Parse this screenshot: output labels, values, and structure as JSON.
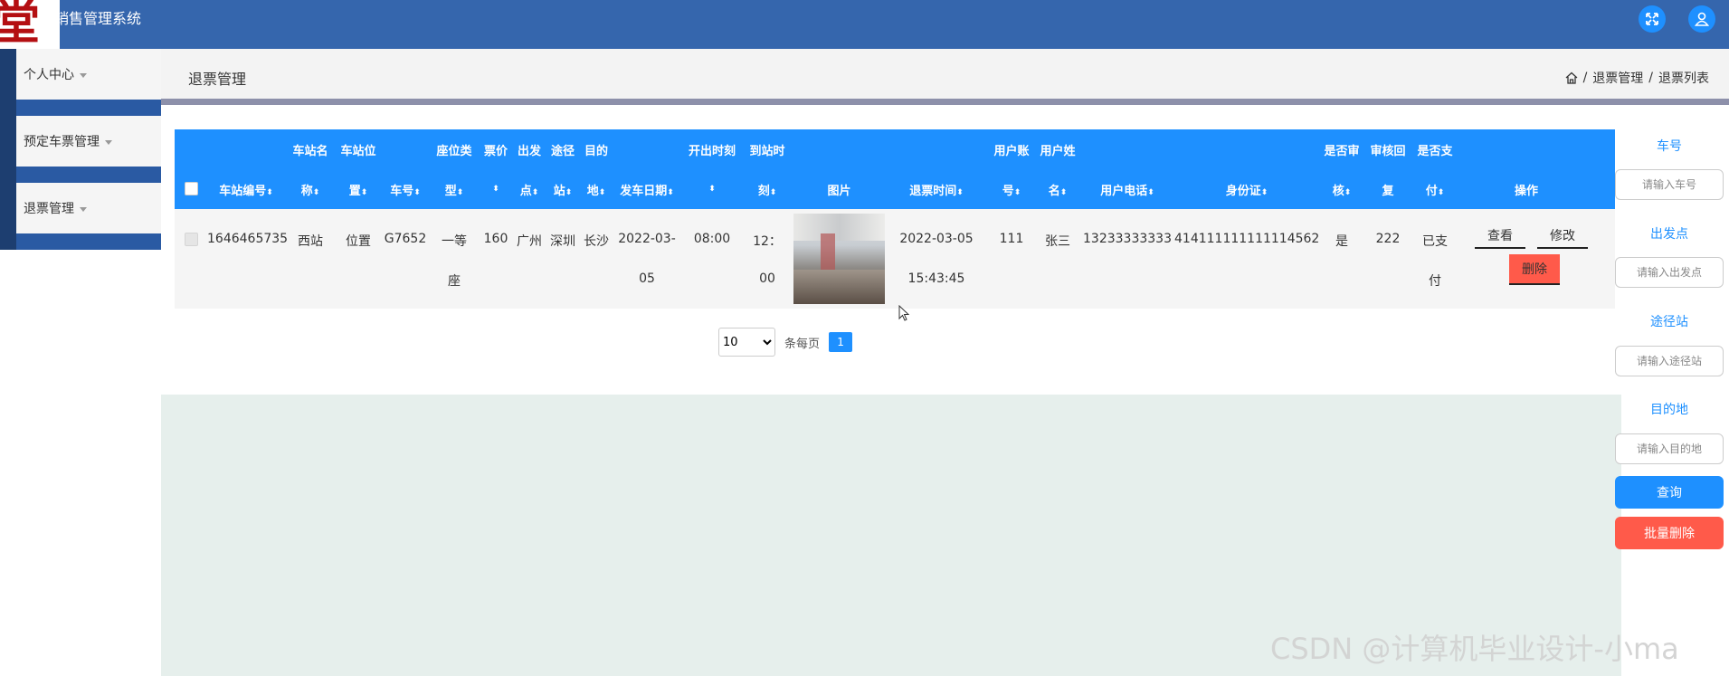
{
  "app": {
    "logo_char": "堂",
    "title": "销售管理系统"
  },
  "topbar": {
    "fullscreen_icon": "expand-icon",
    "user_icon": "user-icon"
  },
  "sidebar": {
    "items": [
      {
        "label": "个人中心"
      },
      {
        "label": "预定车票管理"
      },
      {
        "label": "退票管理"
      }
    ]
  },
  "header": {
    "title": "退票管理",
    "breadcrumb": [
      "退票管理",
      "退票列表"
    ],
    "separator": "/"
  },
  "table": {
    "columns": [
      {
        "l1": "",
        "l2": "车站编号"
      },
      {
        "l1": "车站名",
        "l2": "称"
      },
      {
        "l1": "车站位",
        "l2": "置"
      },
      {
        "l1": "",
        "l2": "车号"
      },
      {
        "l1": "座位类",
        "l2": "型"
      },
      {
        "l1": "票价",
        "l2": ""
      },
      {
        "l1": "出发",
        "l2": "点"
      },
      {
        "l1": "途径",
        "l2": "站"
      },
      {
        "l1": "目的",
        "l2": "地"
      },
      {
        "l1": "",
        "l2": "发车日期"
      },
      {
        "l1": "开出时刻",
        "l2": ""
      },
      {
        "l1": "到站时",
        "l2": "刻"
      },
      {
        "l1": "",
        "l2": "图片"
      },
      {
        "l1": "",
        "l2": "退票时间"
      },
      {
        "l1": "用户账",
        "l2": "号"
      },
      {
        "l1": "用户姓",
        "l2": "名"
      },
      {
        "l1": "",
        "l2": "用户电话"
      },
      {
        "l1": "",
        "l2": "身份证"
      },
      {
        "l1": "是否审",
        "l2": "核"
      },
      {
        "l1": "审核回",
        "l2": "复"
      },
      {
        "l1": "是否支",
        "l2": "付"
      },
      {
        "l1": "",
        "l2": "操作"
      }
    ],
    "rows": [
      {
        "station_no": "1646465735",
        "station_name": "西站",
        "station_pos": "位置",
        "train_no": "G7652",
        "seat_type_1": "一等",
        "seat_type_2": "座",
        "price": "160",
        "depart": "广州",
        "via": "深圳",
        "dest": "长沙",
        "date_1": "2022-03-",
        "date_2": "05",
        "depart_time": "08:00",
        "arrive_1": "12：",
        "arrive_2": "00",
        "refund_time_1": "2022-03-05",
        "refund_time_2": "15:43:45",
        "account": "111",
        "name": "张三",
        "phone": "13233333333",
        "id_card": "414111111111114562",
        "reviewed": "是",
        "reply": "222",
        "paid_1": "已支",
        "paid_2": "付"
      }
    ],
    "actions": {
      "view": "查看",
      "edit": "修改",
      "delete": "删除"
    }
  },
  "pagination": {
    "page_size": "10",
    "per_page_label": "条每页",
    "current_page": "1"
  },
  "search": {
    "fields": [
      {
        "label": "车号",
        "placeholder": "请输入车号"
      },
      {
        "label": "出发点",
        "placeholder": "请输入出发点"
      },
      {
        "label": "途径站",
        "placeholder": "请输入途径站"
      },
      {
        "label": "目的地",
        "placeholder": "请输入目的地"
      }
    ],
    "query_button": "查询",
    "batch_delete_button": "批量删除",
    "query_color": "#1e90ff",
    "delete_color": "#ff5a4a"
  },
  "watermark": "CSDN @计算机毕业设计-小ma",
  "colors": {
    "topbar": "#3566ad",
    "table_header": "#1e90ff",
    "lower_area": "#e6efec"
  }
}
